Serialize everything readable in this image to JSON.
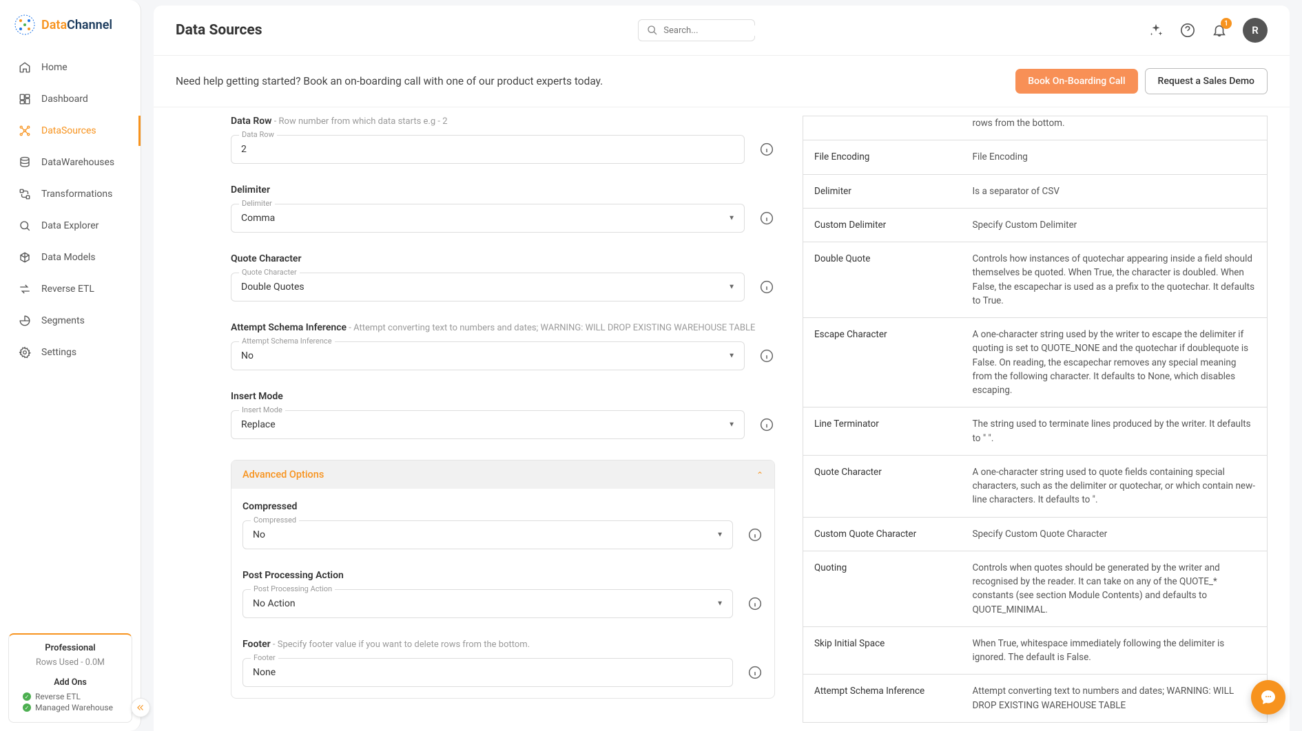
{
  "brand": {
    "part1": "Data",
    "part2": "Channel"
  },
  "nav": {
    "items": [
      {
        "label": "Home"
      },
      {
        "label": "Dashboard"
      },
      {
        "label": "DataSources"
      },
      {
        "label": "DataWarehouses"
      },
      {
        "label": "Transformations"
      },
      {
        "label": "Data Explorer"
      },
      {
        "label": "Data Models"
      },
      {
        "label": "Reverse ETL"
      },
      {
        "label": "Segments"
      },
      {
        "label": "Settings"
      }
    ]
  },
  "plan": {
    "title": "Professional",
    "usage": "Rows Used - 0.0M",
    "addons_title": "Add Ons",
    "addons": [
      {
        "label": "Reverse ETL"
      },
      {
        "label": "Managed Warehouse"
      }
    ]
  },
  "page": {
    "title": "Data Sources"
  },
  "search": {
    "placeholder": "Search..."
  },
  "notif": {
    "count": "1"
  },
  "avatar": {
    "letter": "R"
  },
  "onboard": {
    "text": "Need help getting started? Book an on-boarding call with one of our product experts today.",
    "btn_primary": "Book On-Boarding Call",
    "btn_secondary": "Request a Sales Demo"
  },
  "form": {
    "data_row": {
      "label": "Data Row",
      "hint": " - Row number from which data starts e.g - 2",
      "float": "Data Row",
      "value": "2"
    },
    "delimiter": {
      "label": "Delimiter",
      "float": "Delimiter",
      "value": "Comma"
    },
    "quote_char": {
      "label": "Quote Character",
      "float": "Quote Character",
      "value": "Double Quotes"
    },
    "schema_inf": {
      "label": "Attempt Schema Inference",
      "hint": " - Attempt converting text to numbers and dates; WARNING: WILL DROP EXISTING WAREHOUSE TABLE",
      "float": "Attempt Schema Inference",
      "value": "No"
    },
    "insert_mode": {
      "label": "Insert Mode",
      "float": "Insert Mode",
      "value": "Replace"
    },
    "accordion_title": "Advanced Options",
    "compressed": {
      "label": "Compressed",
      "float": "Compressed",
      "value": "No"
    },
    "post_proc": {
      "label": "Post Processing Action",
      "float": "Post Processing Action",
      "value": "No Action"
    },
    "footer": {
      "label": "Footer",
      "hint": " - Specify footer value if you want to delete rows from the bottom.",
      "float": "Footer",
      "value": "None"
    }
  },
  "help": {
    "rows": [
      {
        "k": "",
        "v": "rows from the bottom."
      },
      {
        "k": "File Encoding",
        "v": "File Encoding"
      },
      {
        "k": "Delimiter",
        "v": "Is a separator of CSV"
      },
      {
        "k": "Custom Delimiter",
        "v": "Specify Custom Delimiter"
      },
      {
        "k": "Double Quote",
        "v": "Controls how instances of quotechar appearing inside a field should themselves be quoted. When True, the character is doubled. When False, the escapechar is used as a prefix to the quotechar. It defaults to True."
      },
      {
        "k": "Escape Character",
        "v": "A one-character string used by the writer to escape the delimiter if quoting is set to QUOTE_NONE and the quotechar if doublequote is False. On reading, the escapechar removes any special meaning from the following character. It defaults to None, which disables escaping."
      },
      {
        "k": "Line Terminator",
        "v": "The string used to terminate lines produced by the writer. It defaults to \" \"."
      },
      {
        "k": "Quote Character",
        "v": "A one-character string used to quote fields containing special characters, such as the delimiter or quotechar, or which contain new-line characters. It defaults to \"."
      },
      {
        "k": "Custom Quote Character",
        "v": "Specify Custom Quote Character"
      },
      {
        "k": "Quoting",
        "v": "Controls when quotes should be generated by the writer and recognised by the reader. It can take on any of the QUOTE_* constants (see section Module Contents) and defaults to QUOTE_MINIMAL."
      },
      {
        "k": "Skip Initial Space",
        "v": "When True, whitespace immediately following the delimiter is ignored. The default is False."
      },
      {
        "k": "Attempt Schema Inference",
        "v": "Attempt converting text to numbers and dates; WARNING: WILL DROP EXISTING WAREHOUSE TABLE"
      }
    ]
  }
}
